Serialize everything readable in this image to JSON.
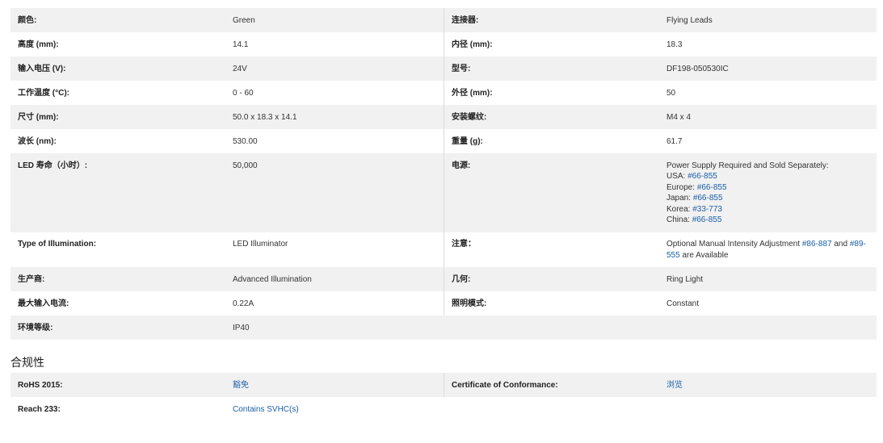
{
  "specs": [
    {
      "l1": "颜色:",
      "v1": "Green",
      "l2": "连接器:",
      "v2": "Flying Leads"
    },
    {
      "l1": "高度 (mm):",
      "v1": "14.1",
      "l2": "内径 (mm):",
      "v2": "18.3"
    },
    {
      "l1": "输入电压 (V):",
      "v1": "24V",
      "l2": "型号:",
      "v2": "DF198-050530IC"
    },
    {
      "l1": "工作温度 (°C):",
      "v1": "0 - 60",
      "l2": "外径 (mm):",
      "v2": "50"
    },
    {
      "l1": "尺寸 (mm):",
      "v1": "50.0 x 18.3 x 14.1",
      "l2": "安装螺纹:",
      "v2": "M4 x 4"
    },
    {
      "l1": "波长 (nm):",
      "v1": "530.00",
      "l2": "重量 (g):",
      "v2": "61.7"
    },
    {
      "l1": "LED 寿命（小时）:",
      "v1": "50,000",
      "l2": "电源:"
    },
    {
      "l1": "Type of Illumination:",
      "v1": "LED Illuminator",
      "l2": "注意："
    },
    {
      "l1": "生产商:",
      "v1": "Advanced Illumination",
      "l2": "几何:",
      "v2": "Ring Light"
    },
    {
      "l1": "最大输入电流:",
      "v1": "0.22A",
      "l2": "照明模式:",
      "v2": "Constant"
    },
    {
      "l1": "环境等级:",
      "v1": "IP40"
    }
  ],
  "power_supply": {
    "intro": "Power Supply Required and Sold Separately:",
    "usa_label": "USA: ",
    "usa_link": "#66-855",
    "europe_label": "Europe: ",
    "europe_link": "#66-855",
    "japan_label": "Japan: ",
    "japan_link": "#66-855",
    "korea_label": "Korea: ",
    "korea_link": "#33-773",
    "china_label": "China: ",
    "china_link": "#66-855"
  },
  "note": {
    "text1": "Optional Manual Intensity Adjustment ",
    "link1": "#86-887",
    "text2": " and ",
    "link2": "#89-555",
    "text3": " are Available"
  },
  "compliance": {
    "title": "合规性",
    "rohs_label": "RoHS 2015:",
    "rohs_value": "豁免",
    "coc_label": "Certificate of Conformance:",
    "coc_value": "浏览",
    "reach_label": "Reach 233:",
    "reach_value": "Contains SVHC(s)"
  }
}
